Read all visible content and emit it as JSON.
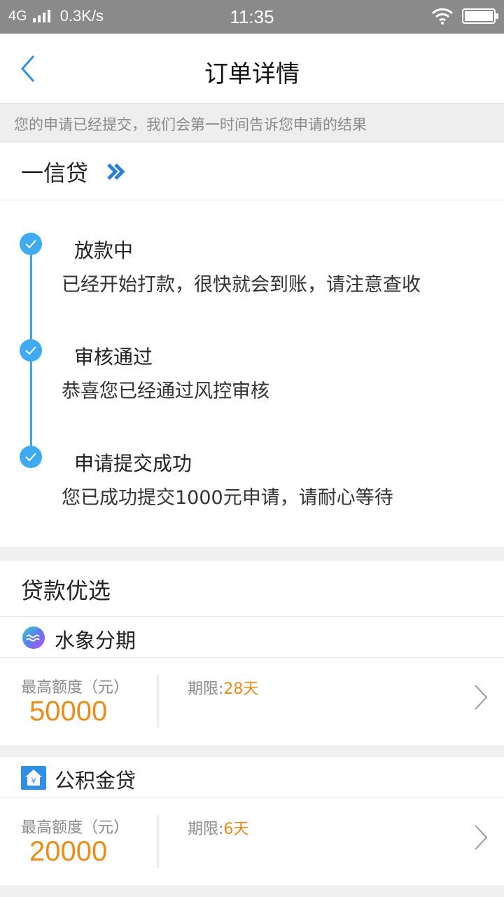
{
  "status_bar": {
    "network": "4G",
    "speed": "0.3K/s",
    "time": "11:35"
  },
  "header": {
    "title": "订单详情"
  },
  "notice": "您的申请已经提交，我们会第一时间告诉您申请的结果",
  "product": {
    "name": "一信贷"
  },
  "timeline": [
    {
      "title": "放款中",
      "desc": "已经开始打款，很快就会到账，请注意查收"
    },
    {
      "title": "审核通过",
      "desc": "恭喜您已经通过风控审核"
    },
    {
      "title": "申请提交成功",
      "desc": "您已成功提交1000元申请，请耐心等待"
    }
  ],
  "recommend": {
    "title": "贷款优选",
    "cards": [
      {
        "name": "水象分期",
        "amount_label": "最高额度（元）",
        "amount": "50000",
        "term_label": "期限:",
        "term_value": "28天"
      },
      {
        "name": "公积金贷",
        "amount_label": "最高额度（元）",
        "amount": "20000",
        "term_label": "期限:",
        "term_value": "6天"
      }
    ]
  },
  "colors": {
    "accent": "#3fa4ec",
    "amount": "#e88c1a"
  }
}
